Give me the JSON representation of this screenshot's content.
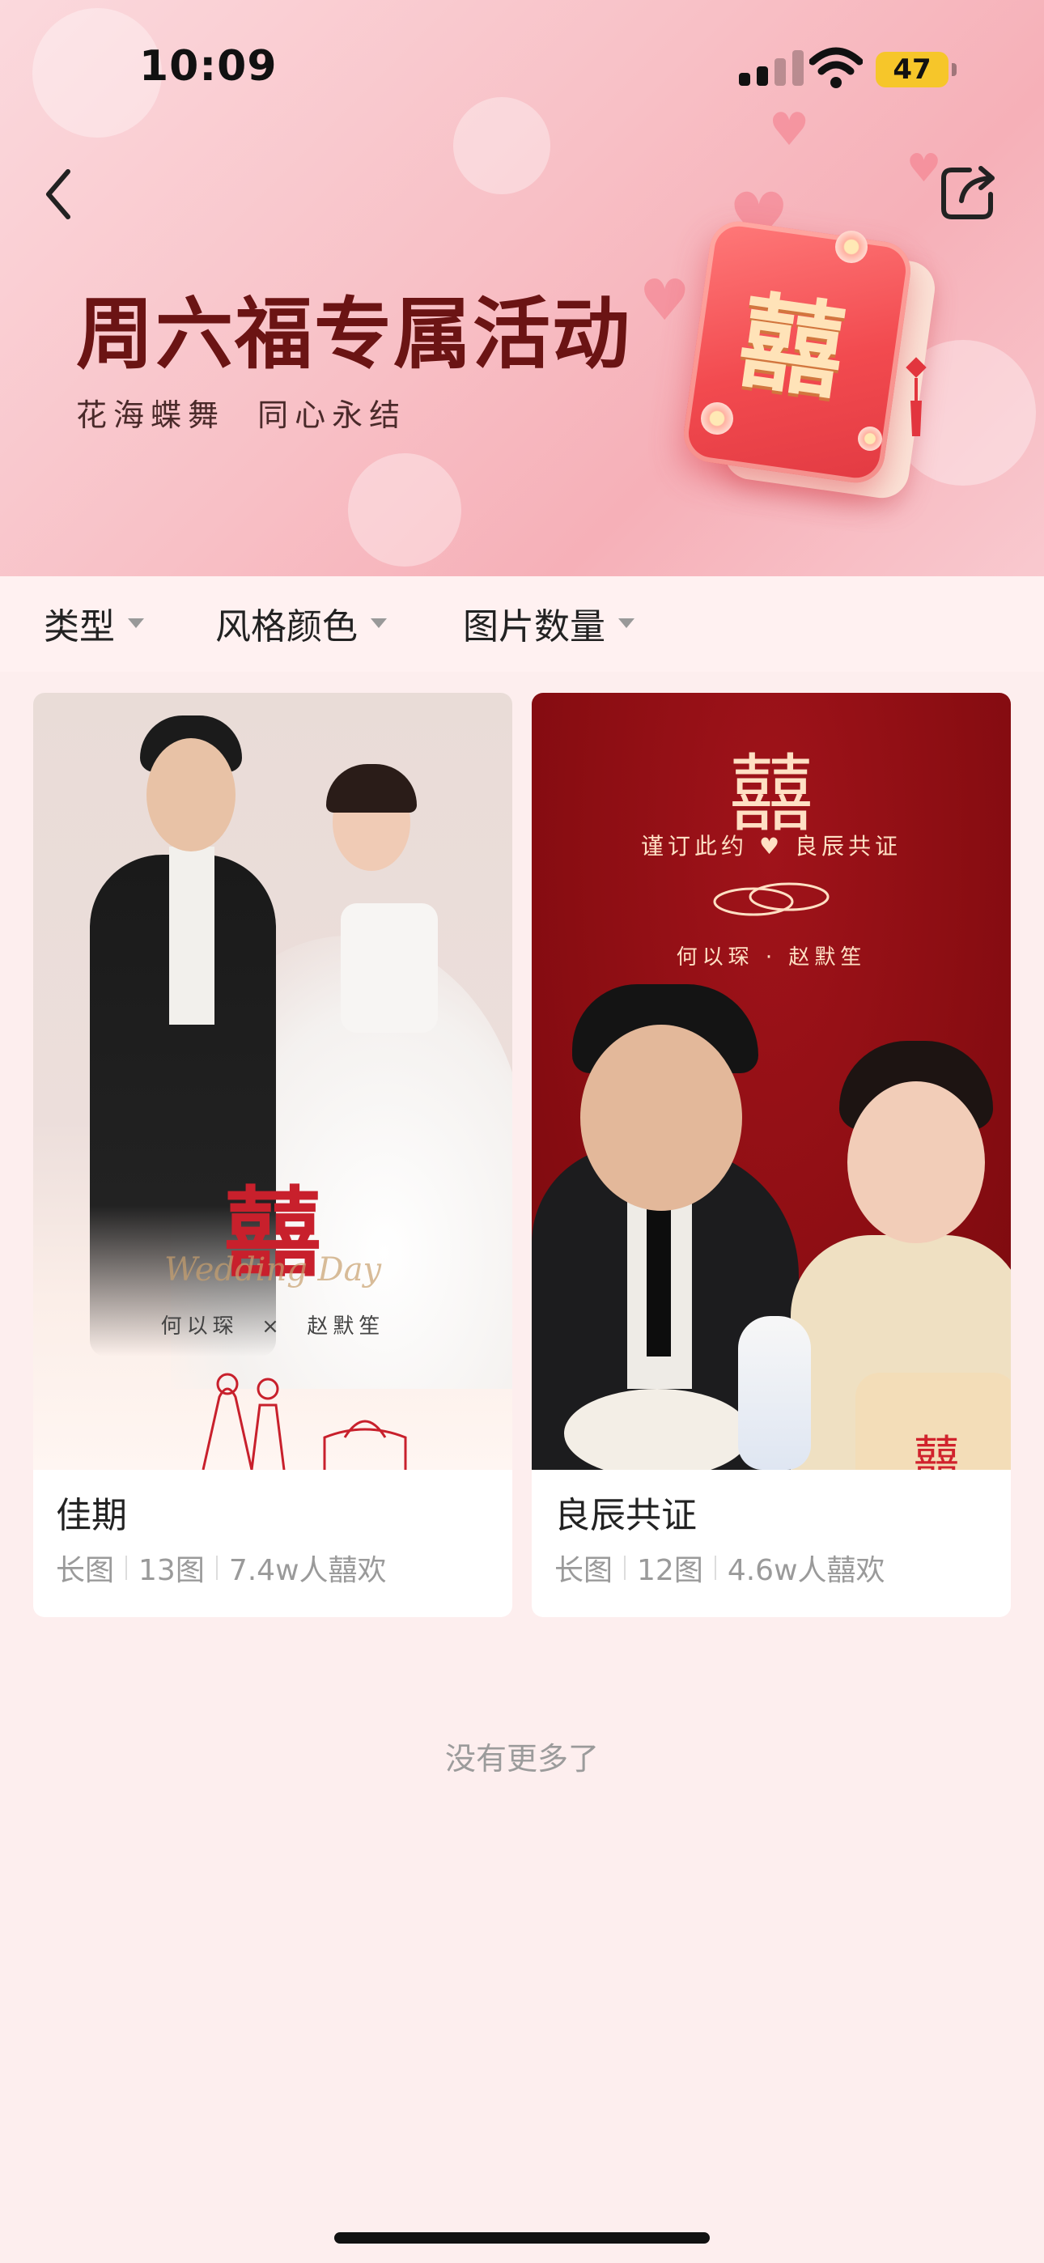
{
  "status_bar": {
    "time": "10:09",
    "battery": "47",
    "battery_color": "#f6c62a"
  },
  "nav": {
    "back_icon": "chevron-left-icon",
    "share_icon": "share-icon"
  },
  "banner": {
    "title": "周六福专属活动",
    "subtitle": "花海蝶舞  同心永结",
    "emblem_text": "囍",
    "title_color": "#6b1414"
  },
  "filters": [
    {
      "label": "类型"
    },
    {
      "label": "风格颜色"
    },
    {
      "label": "图片数量"
    }
  ],
  "cards": [
    {
      "title": "佳期",
      "meta": [
        "长图",
        "13图",
        "7.4w人囍欢"
      ],
      "thumb": {
        "emblem": "囍",
        "script": "Wedding Day",
        "names": "何以琛  ×  赵默笙"
      }
    },
    {
      "title": "良辰共证",
      "meta": [
        "长图",
        "12图",
        "4.6w人囍欢"
      ],
      "thumb": {
        "emblem": "囍",
        "tagline": "谨订此约 ♥ 良辰共证",
        "names": "何以琛 · 赵默笙",
        "cup_text": "囍"
      }
    }
  ],
  "footer": {
    "no_more": "没有更多了"
  },
  "colors": {
    "page_bg": "#fdeeee",
    "accent_red": "#c8202c"
  }
}
